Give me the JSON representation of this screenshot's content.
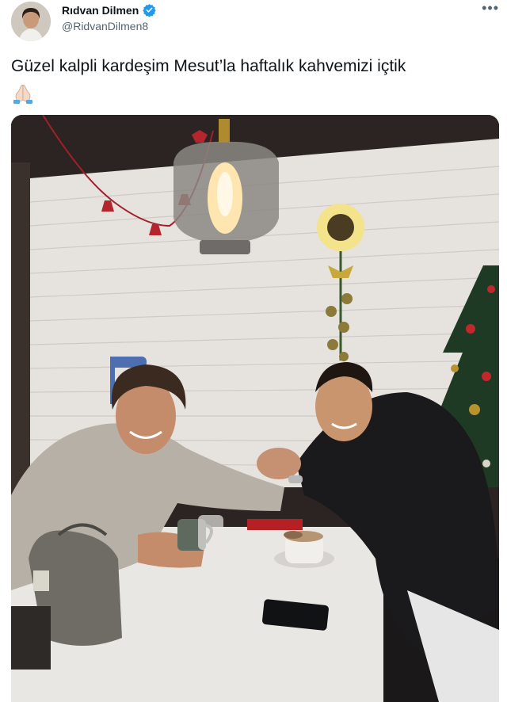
{
  "author": {
    "display_name": "Rıdvan Dilmen",
    "handle": "@RidvanDilmen8",
    "avatar_icon": "profile-photo",
    "verified_icon": "verified-badge-icon",
    "verified_color": "#1d9bf0"
  },
  "menu": {
    "more_label": "•••"
  },
  "tweet": {
    "text": "Güzel kalpli kardeşim Mesut’la haftalık kahvemizi içtik",
    "emoji": "praying-hands-icon"
  },
  "media": {
    "kind": "photo",
    "subject_icons": [
      "person-left",
      "person-right",
      "pendant-lamp",
      "christmas-tree",
      "coffee-cups",
      "phone"
    ]
  },
  "colors": {
    "text_primary": "#0f1419",
    "text_secondary": "#536471"
  }
}
